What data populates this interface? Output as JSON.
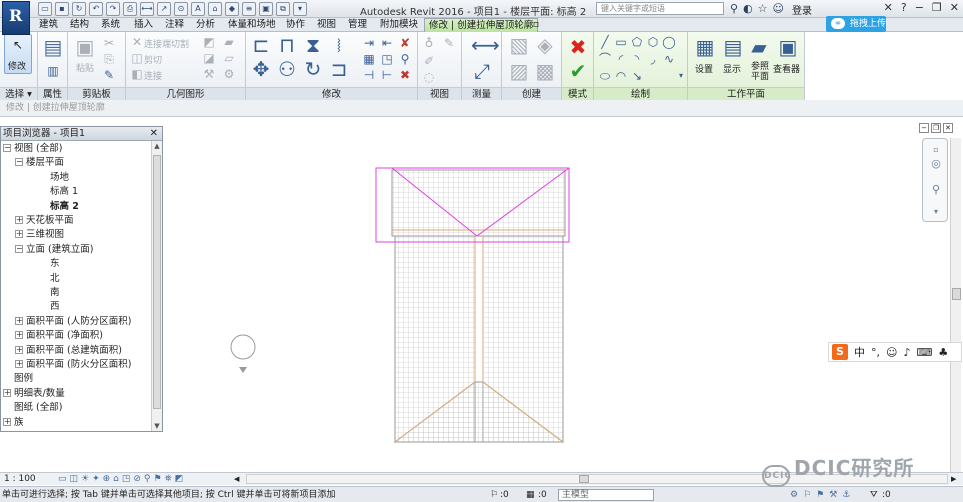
{
  "app": {
    "logo_letter": "R",
    "window_title": "Autodesk Revit 2016 -    项目1 - 楼层平面: 标高 2",
    "search_placeholder": "键入关键字或短语",
    "login_label": "登录"
  },
  "tabs": [
    {
      "label": "建筑"
    },
    {
      "label": "结构"
    },
    {
      "label": "系统"
    },
    {
      "label": "插入"
    },
    {
      "label": "注释"
    },
    {
      "label": "分析"
    },
    {
      "label": "体量和场地"
    },
    {
      "label": "协作"
    },
    {
      "label": "视图"
    },
    {
      "label": "管理"
    },
    {
      "label": "附加模块"
    },
    {
      "label": "修改 | 创建拉伸屋顶轮廓"
    }
  ],
  "upload_label": "拖拽上传",
  "ribbon": {
    "select_panel": "选择",
    "select_dropdown": "选择 ▾",
    "modify_button": "修改",
    "properties_panel": "属性",
    "clipboard_panel": "剪贴板",
    "paste_label": "粘贴",
    "geometry_panel": "几何图形",
    "geometry_items": [
      "连接端切割",
      "剪切",
      "连接"
    ],
    "modify_panel": "修改",
    "view_panel": "视图",
    "measure_panel": "测量",
    "create_panel": "创建",
    "mode_panel": "模式",
    "draw_panel": "绘制",
    "workplane_panel": "工作平面",
    "workplane_buttons": [
      {
        "label": "设置"
      },
      {
        "label": "显示"
      },
      {
        "label": "参照平面"
      },
      {
        "label": "查看器"
      }
    ]
  },
  "options_bar": {
    "text": "修改 | 创建拉伸屋顶轮廓"
  },
  "project_browser": {
    "title": "项目浏览器 - 项目1",
    "nodes": [
      {
        "label": "视图 (全部)",
        "indent": 0,
        "exp": "−",
        "bold": false
      },
      {
        "label": "楼层平面",
        "indent": 1,
        "exp": "−",
        "bold": false
      },
      {
        "label": "场地",
        "indent": 3,
        "exp": "",
        "bold": false
      },
      {
        "label": "标高 1",
        "indent": 3,
        "exp": "",
        "bold": false
      },
      {
        "label": "标高 2",
        "indent": 3,
        "exp": "",
        "bold": true
      },
      {
        "label": "天花板平面",
        "indent": 1,
        "exp": "+",
        "bold": false
      },
      {
        "label": "三维视图",
        "indent": 1,
        "exp": "+",
        "bold": false
      },
      {
        "label": "立面 (建筑立面)",
        "indent": 1,
        "exp": "−",
        "bold": false
      },
      {
        "label": "东",
        "indent": 3,
        "exp": "",
        "bold": false
      },
      {
        "label": "北",
        "indent": 3,
        "exp": "",
        "bold": false
      },
      {
        "label": "南",
        "indent": 3,
        "exp": "",
        "bold": false
      },
      {
        "label": "西",
        "indent": 3,
        "exp": "",
        "bold": false
      },
      {
        "label": "面积平面 (人防分区面积)",
        "indent": 1,
        "exp": "+",
        "bold": false
      },
      {
        "label": "面积平面 (净面积)",
        "indent": 1,
        "exp": "+",
        "bold": false
      },
      {
        "label": "面积平面 (总建筑面积)",
        "indent": 1,
        "exp": "+",
        "bold": false
      },
      {
        "label": "面积平面 (防火分区面积)",
        "indent": 1,
        "exp": "+",
        "bold": false
      },
      {
        "label": "图例",
        "indent": 0,
        "exp": "",
        "bold": false
      },
      {
        "label": "明细表/数量",
        "indent": 0,
        "exp": "+",
        "bold": false
      },
      {
        "label": "图纸 (全部)",
        "indent": 0,
        "exp": "",
        "bold": false
      },
      {
        "label": "族",
        "indent": 0,
        "exp": "+",
        "bold": false
      }
    ]
  },
  "view_bar": {
    "scale": "1 : 100"
  },
  "status": {
    "hint": "单击可进行选择; 按 Tab 键并单击可选择其他项目; 按 Ctrl 键并单击可将新项目添加",
    "workset_count": ":0",
    "design_option_count": ":0",
    "model_label": "主模型",
    "filter_count": ":0"
  },
  "ime": {
    "logo": "S",
    "lang": "中"
  },
  "watermark": {
    "text": "DCIC研究所",
    "logo_text": "DCIC"
  },
  "colors": {
    "sketch_magenta": "#e040e0",
    "grid_gray": "#b8b8b8",
    "ribbon_context_green": "#d6ebc7",
    "upload_blue": "#2ea3e3"
  }
}
